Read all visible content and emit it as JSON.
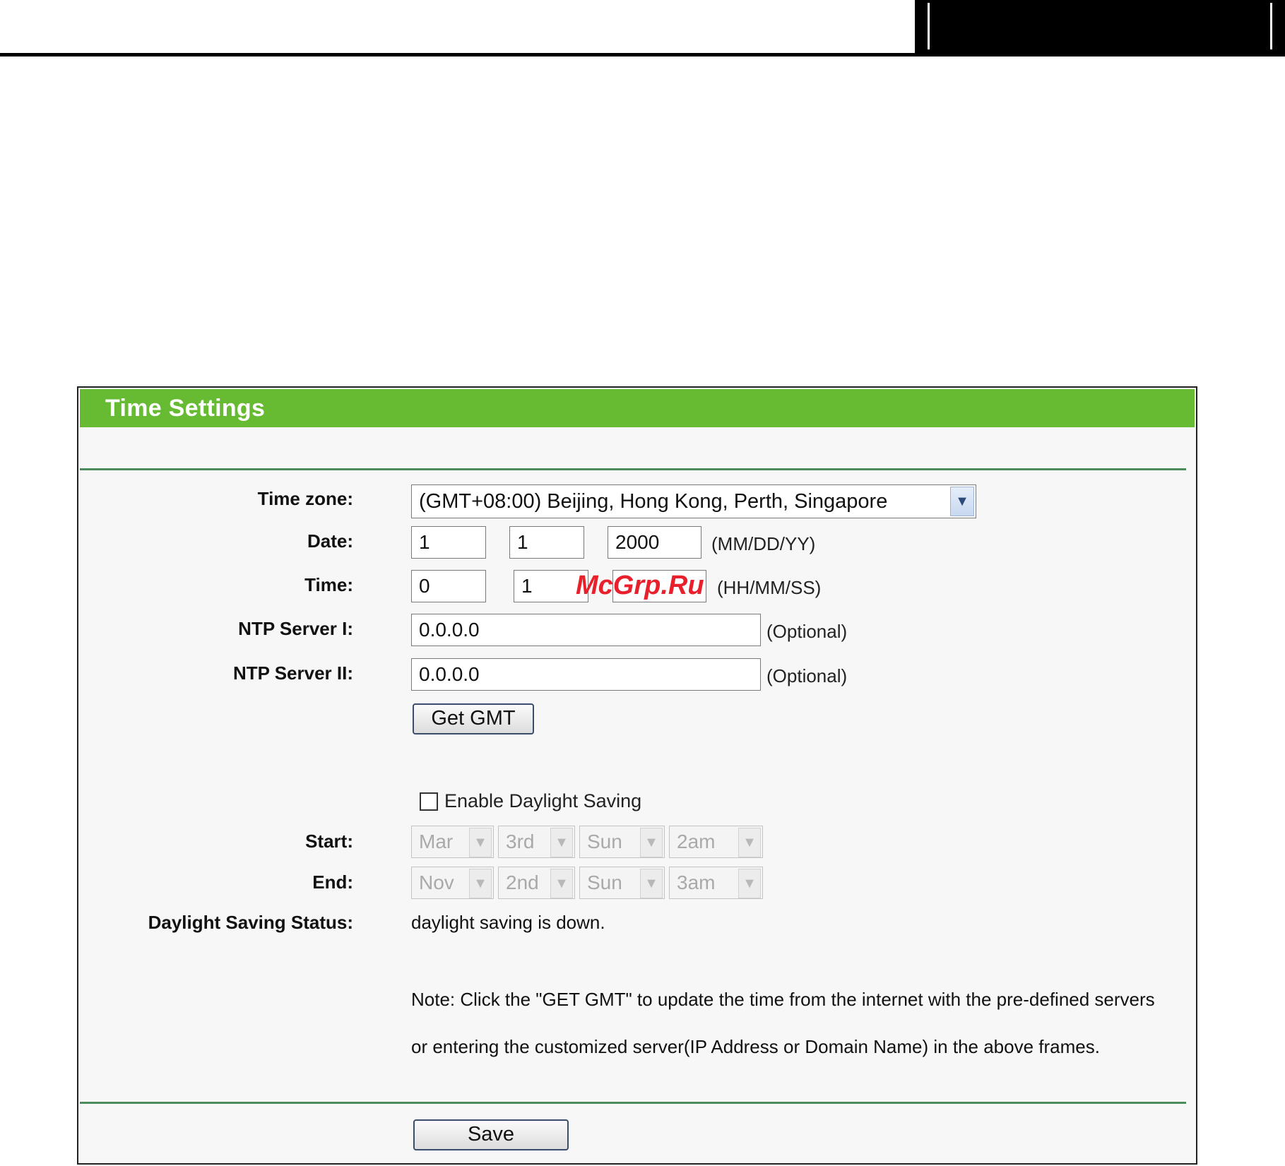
{
  "panel": {
    "title": "Time Settings"
  },
  "form": {
    "timezone": {
      "label": "Time zone:",
      "value": "(GMT+08:00) Beijing, Hong Kong, Perth, Singapore"
    },
    "date": {
      "label": "Date:",
      "month": "1",
      "day": "1",
      "year": "2000",
      "format_hint": "(MM/DD/YY)"
    },
    "time": {
      "label": "Time:",
      "hour": "0",
      "minute": "1",
      "second": "",
      "format_hint": "(HH/MM/SS)"
    },
    "ntp1": {
      "label": "NTP Server I:",
      "value": "0.0.0.0",
      "hint": "(Optional)"
    },
    "ntp2": {
      "label": "NTP Server II:",
      "value": "0.0.0.0",
      "hint": "(Optional)"
    },
    "get_gmt_label": "Get GMT",
    "daylight": {
      "checkbox_label": "Enable Daylight Saving",
      "checked": false
    },
    "start": {
      "label": "Start:",
      "month": "Mar",
      "week": "3rd",
      "day": "Sun",
      "hour": "2am"
    },
    "end": {
      "label": "End:",
      "month": "Nov",
      "week": "2nd",
      "day": "Sun",
      "hour": "3am"
    },
    "status": {
      "label": "Daylight Saving Status:",
      "value": "daylight saving is down."
    },
    "note_line1": "Note: Click the \"GET GMT\" to update the time from the internet with the pre-defined servers",
    "note_line2": "or entering the customized server(IP Address or Domain Name) in the above frames.",
    "save_label": "Save"
  },
  "watermark": "McGrp.Ru",
  "icons": {
    "dropdown": "chevron-down-icon"
  },
  "colors": {
    "header_green": "#66bb33",
    "rule_green": "#4c8c5c"
  }
}
